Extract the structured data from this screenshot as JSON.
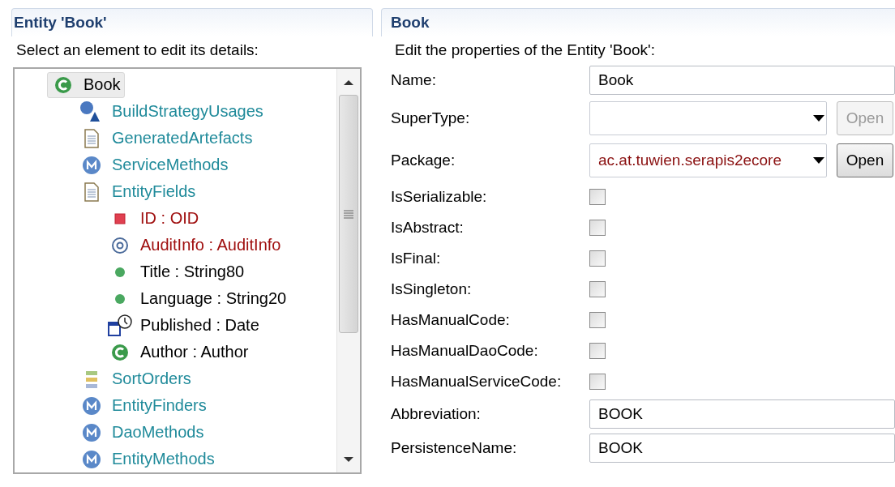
{
  "left_panel": {
    "title": "Entity 'Book'",
    "instruction": "Select an element to edit its details:",
    "tree": [
      {
        "label": "Book",
        "kind": "class",
        "color": "#000000",
        "selected": true,
        "children": [
          {
            "label": "BuildStrategyUsages",
            "kind": "strategy",
            "color": "#1f8a9a",
            "selected": false
          },
          {
            "label": "GeneratedArtefacts",
            "kind": "document",
            "color": "#1f8a9a",
            "selected": false
          },
          {
            "label": "ServiceMethods",
            "kind": "method",
            "color": "#1f8a9a",
            "selected": false
          },
          {
            "label": "EntityFields",
            "kind": "document",
            "color": "#1f8a9a",
            "selected": false,
            "children": [
              {
                "label": "ID : OID",
                "kind": "key",
                "color": "#a01010",
                "selected": false
              },
              {
                "label": "AuditInfo : AuditInfo",
                "kind": "at",
                "color": "#a01010",
                "selected": false
              },
              {
                "label": "Title : String80",
                "kind": "attribute",
                "color": "#000000",
                "selected": false
              },
              {
                "label": "Language : String20",
                "kind": "attribute",
                "color": "#000000",
                "selected": false
              },
              {
                "label": "Published : Date",
                "kind": "date",
                "color": "#000000",
                "selected": false
              },
              {
                "label": "Author : Author",
                "kind": "class",
                "color": "#000000",
                "selected": false
              }
            ]
          },
          {
            "label": "SortOrders",
            "kind": "sort",
            "color": "#1f8a9a",
            "selected": false
          },
          {
            "label": "EntityFinders",
            "kind": "method",
            "color": "#1f8a9a",
            "selected": false
          },
          {
            "label": "DaoMethods",
            "kind": "method",
            "color": "#1f8a9a",
            "selected": false
          },
          {
            "label": "EntityMethods",
            "kind": "method",
            "color": "#1f8a9a",
            "selected": false
          }
        ]
      }
    ]
  },
  "right_panel": {
    "title": "Book",
    "instruction": "Edit the properties of the Entity 'Book':",
    "fields": [
      {
        "kind": "text",
        "label": "Name:",
        "value": "Book"
      },
      {
        "kind": "combo",
        "label": "SuperType:",
        "button": "Open",
        "disabled": true
      },
      {
        "kind": "combo",
        "label": "Package:",
        "value": "ac.at.tuwien.serapis2ecore",
        "button": "Open",
        "disabled": false
      },
      {
        "kind": "checkbox",
        "label": "IsSerializable:",
        "checked": false
      },
      {
        "kind": "checkbox",
        "label": "IsAbstract:",
        "checked": false
      },
      {
        "kind": "checkbox",
        "label": "IsFinal:",
        "checked": false
      },
      {
        "kind": "checkbox",
        "label": "IsSingleton:",
        "checked": false
      },
      {
        "kind": "checkbox",
        "label": "HasManualCode:",
        "checked": false
      },
      {
        "kind": "checkbox",
        "label": "HasManualDaoCode:",
        "checked": false
      },
      {
        "kind": "checkbox",
        "label": "HasManualServiceCode:",
        "checked": false
      },
      {
        "kind": "text",
        "label": "Abbreviation:",
        "value": "BOOK"
      },
      {
        "kind": "text",
        "label": "PersistenceName:",
        "value": "BOOK"
      }
    ]
  }
}
